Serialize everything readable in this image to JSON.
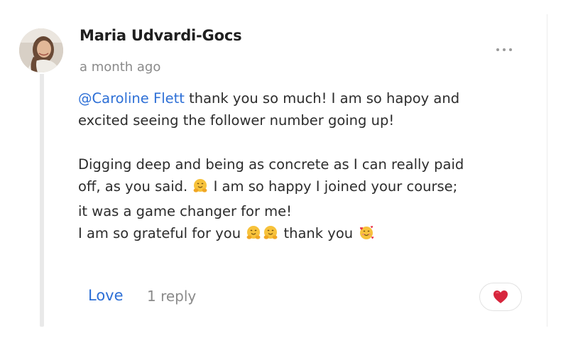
{
  "comment": {
    "author": "Maria Udvardi-Gocs",
    "timestamp": "a month ago",
    "more_icon": "more-horizontal-icon",
    "body": {
      "mention": "@Caroline Flett",
      "line1_rest": " thank you so much! I am so hapoy and",
      "line2": "excited seeing the follower number going up!",
      "line3": "Digging deep and being as concrete as I can really paid",
      "line4_a": "off, as you said.",
      "line4_emoji": "hugging-face-emoji",
      "line4_b": "I am so happy I joined your course;",
      "line5": "it was a game changer for me!",
      "line6_a": "I am so grateful for you",
      "line6_emojis": [
        "hugging-face-emoji",
        "hugging-face-emoji"
      ],
      "line6_b": "thank you",
      "line6_end_emoji": "smiling-face-with-hearts-emoji"
    }
  },
  "actions": {
    "love_label": "Love",
    "reply_label": "1 reply",
    "reaction_icon": "red-heart-icon"
  },
  "colors": {
    "mention": "#2d6fd6",
    "love": "#2d6fd6",
    "muted": "#8a8a8a",
    "heart": "#d7263d"
  }
}
